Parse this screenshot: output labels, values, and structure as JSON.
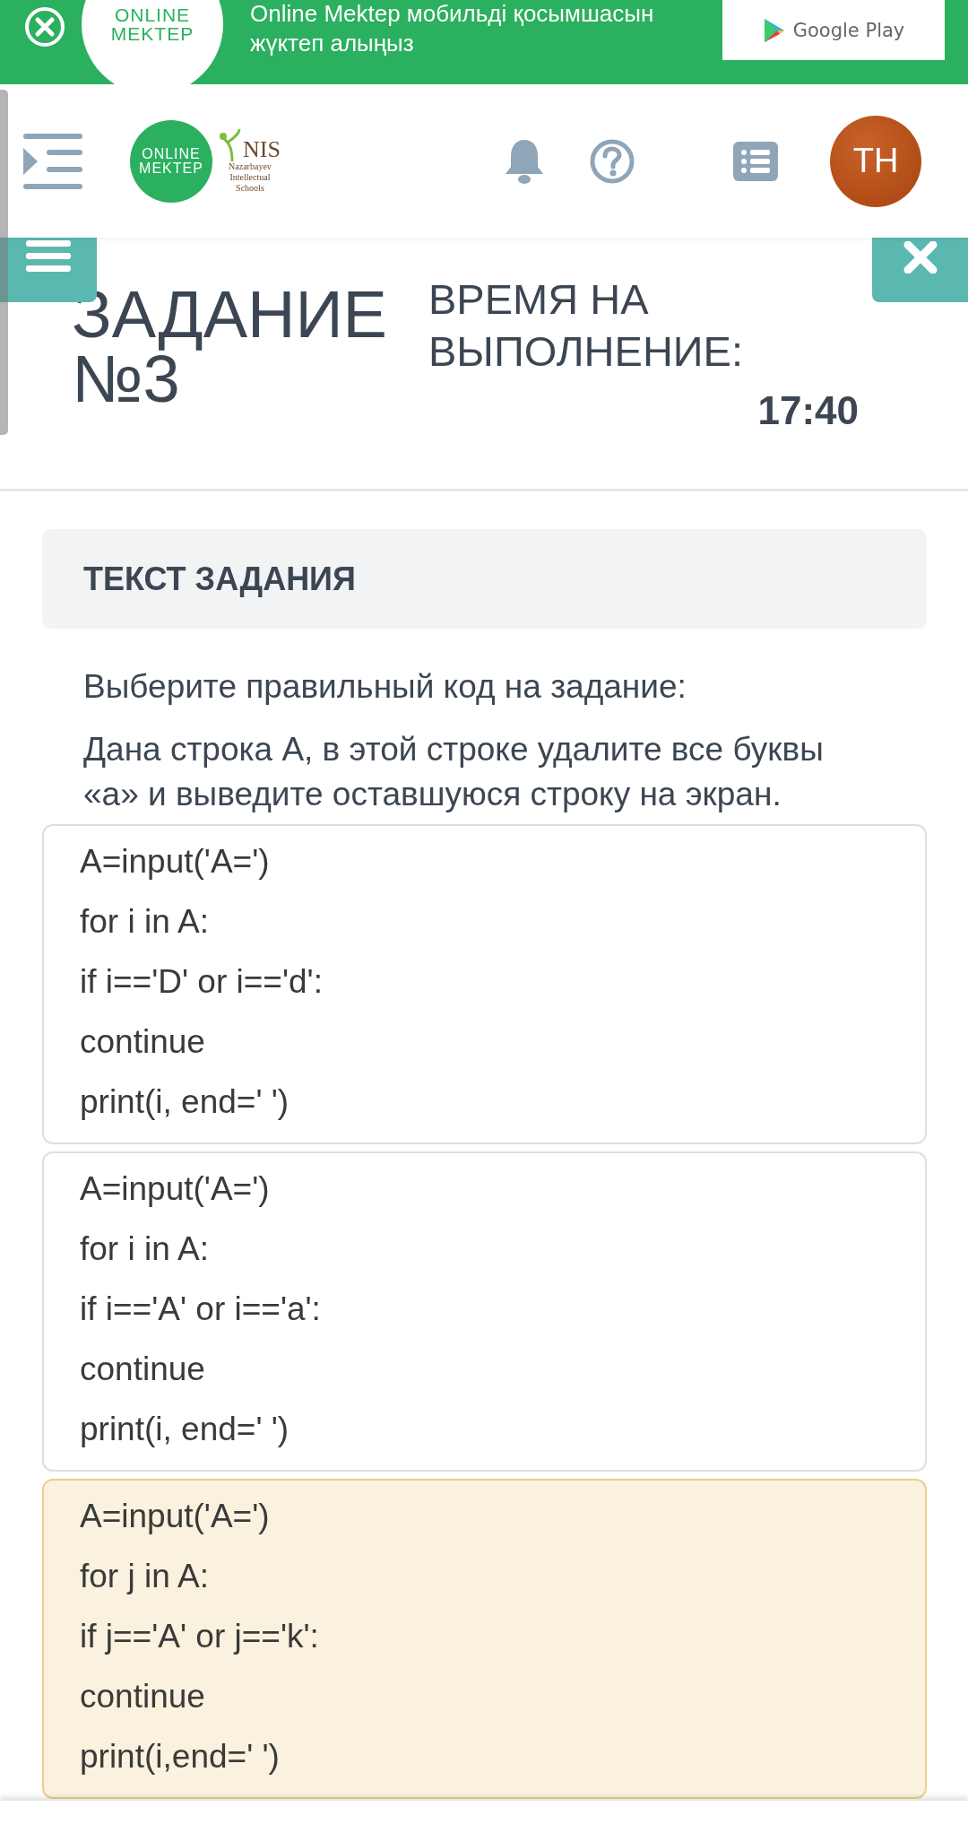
{
  "banner": {
    "logo": [
      "ONLINE",
      "MEKTEP"
    ],
    "message": "Online Mektep мобильді қосымшасын жүктеп алыңыз",
    "store_button": "Google Play"
  },
  "header": {
    "logo": [
      "ONLINE",
      "MEKTEP"
    ],
    "partner_logo": {
      "name": "NIS",
      "subtitle": [
        "Nazarbayev",
        "Intellectual",
        "Schools"
      ]
    },
    "avatar": "TH"
  },
  "task": {
    "title": [
      "ЗАДАНИЕ",
      "№3"
    ],
    "timer_label": [
      "ВРЕМЯ НА",
      "ВЫПОЛНЕНИЕ:"
    ],
    "timer": "17:40"
  },
  "task_text": {
    "heading": "ТЕКСТ ЗАДАНИЯ",
    "paragraphs": [
      "Выберите правильный код на задание:",
      "Дана строка А, в этой строке удалите все буквы «а» и выведите оставшуюся строку на экран."
    ]
  },
  "options": [
    {
      "selected": false,
      "lines": [
        "A=input('A=')",
        "for i in A:",
        "if i=='D' or i=='d':",
        "continue",
        "print(i, end=' ')"
      ]
    },
    {
      "selected": false,
      "lines": [
        "A=input('A=')",
        "for i in A:",
        "if i=='A' or i=='a':",
        "continue",
        "print(i, end=' ')"
      ]
    },
    {
      "selected": true,
      "lines": [
        "A=input('A=')",
        "for j in A:",
        "if j=='A' or j=='k':",
        "continue",
        "print(i,end=' ')"
      ]
    }
  ]
}
